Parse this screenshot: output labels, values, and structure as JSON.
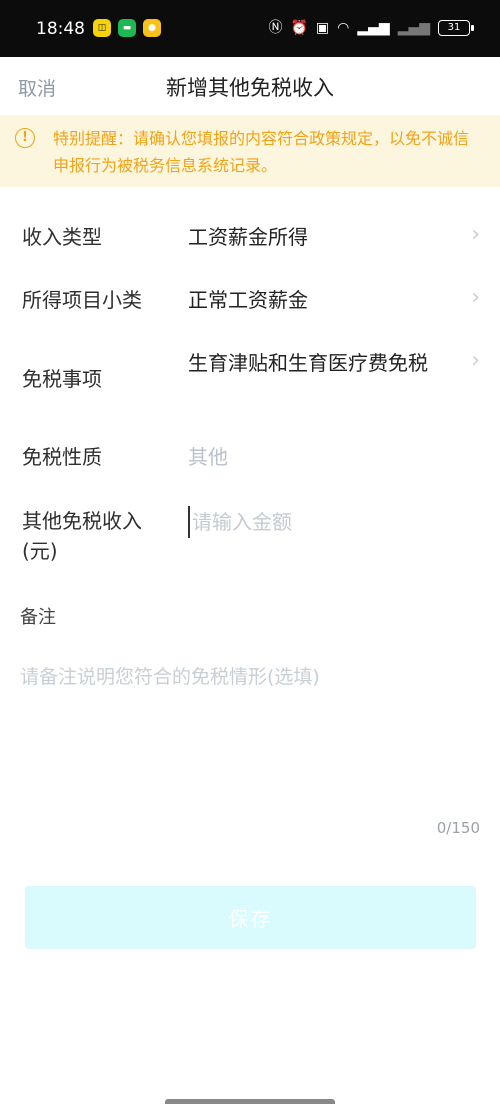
{
  "status_bar": {
    "time": "18:48",
    "battery": "31",
    "icons": [
      "nfc-icon",
      "alarm-icon",
      "hd-icon",
      "wifi-icon",
      "5g-signal-icon",
      "signal-icon"
    ]
  },
  "nav": {
    "cancel": "取消",
    "title": "新增其他免税收入"
  },
  "notice": {
    "text": "特别提醒：请确认您填报的内容符合政策规定，以免不诚信申报行为被税务信息系统记录。",
    "color": "#f0a318"
  },
  "form": {
    "income_type": {
      "label": "收入类型",
      "value": "工资薪金所得"
    },
    "sub_category": {
      "label": "所得项目小类",
      "value": "正常工资薪金"
    },
    "exemption_item": {
      "label": "免税事项",
      "value": "生育津贴和生育医疗费免税"
    },
    "exemption_nature": {
      "label": "免税性质",
      "value": "其他"
    },
    "amount": {
      "label": "其他免税收入(元)",
      "placeholder": "请输入金额",
      "value": ""
    },
    "remarks": {
      "label": "备注",
      "placeholder": "请备注说明您符合的免税情形(选填)",
      "counter": "0/150"
    }
  },
  "save_button": "保存",
  "colors": {
    "accent_disabled": "#d9fbfd",
    "notice_bg": "#fdf6df"
  }
}
